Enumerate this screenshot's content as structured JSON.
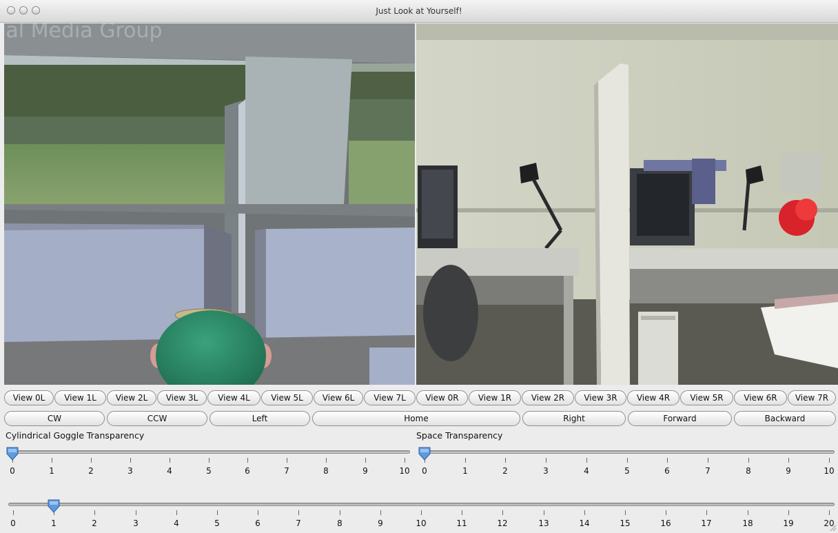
{
  "window": {
    "title": "Just Look at Yourself!",
    "left_overlay_text": "ial Media Group"
  },
  "view_buttons": [
    "View 0L",
    "View 1L",
    "View 2L",
    "View 3L",
    "View 4L",
    "View 5L",
    "View 6L",
    "View 7L",
    "View 0R",
    "View 1R",
    "View 2R",
    "View 3R",
    "View 4R",
    "View 5R",
    "View 6R",
    "View 7R"
  ],
  "nav_buttons": [
    "CW",
    "CCW",
    "Left",
    "Home",
    "Right",
    "Forward",
    "Backward"
  ],
  "sliders": {
    "goggle": {
      "label": "Cylindrical Goggle Transparency",
      "value": 0,
      "min": 0,
      "max": 10,
      "ticks": [
        "0",
        "1",
        "2",
        "3",
        "4",
        "5",
        "6",
        "7",
        "8",
        "9",
        "10"
      ]
    },
    "space": {
      "label": "Space Transparency",
      "value": 0,
      "min": 0,
      "max": 10,
      "ticks": [
        "0",
        "1",
        "2",
        "3",
        "4",
        "5",
        "6",
        "7",
        "8",
        "9",
        "10"
      ]
    },
    "bottom": {
      "label": "",
      "value": 1,
      "min": 0,
      "max": 20,
      "ticks": [
        "0",
        "1",
        "2",
        "3",
        "4",
        "5",
        "6",
        "7",
        "8",
        "9",
        "10",
        "11",
        "12",
        "13",
        "14",
        "15",
        "16",
        "17",
        "18",
        "19",
        "20"
      ]
    }
  },
  "colors": {
    "slider_thumb": "#5c9be0",
    "avatar_head": "#2e8b6a"
  }
}
